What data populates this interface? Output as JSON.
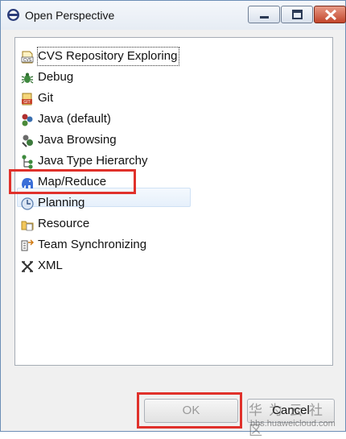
{
  "window": {
    "title": "Open Perspective",
    "title_icon": "perspective-icon"
  },
  "perspectives": [
    {
      "label": "CVS Repository Exploring",
      "icon": "cvs-icon"
    },
    {
      "label": "Debug",
      "icon": "debug-bug-icon"
    },
    {
      "label": "Git",
      "icon": "git-icon"
    },
    {
      "label": "Java (default)",
      "icon": "java-icon"
    },
    {
      "label": "Java Browsing",
      "icon": "java-browsing-icon"
    },
    {
      "label": "Java Type Hierarchy",
      "icon": "type-hierarchy-icon"
    },
    {
      "label": "Map/Reduce",
      "icon": "elephant-icon"
    },
    {
      "label": "Planning",
      "icon": "planning-icon"
    },
    {
      "label": "Resource",
      "icon": "resource-folder-icon"
    },
    {
      "label": "Team Synchronizing",
      "icon": "team-sync-icon"
    },
    {
      "label": "XML",
      "icon": "xml-icon"
    }
  ],
  "buttons": {
    "ok": "OK",
    "cancel": "Cancel"
  },
  "watermark": {
    "chinese": "华为云社区",
    "url": "bbs.huaweicloud.com"
  },
  "colors": {
    "highlight_box": "#e0312b",
    "disabled_text": "#9a9a9a"
  }
}
